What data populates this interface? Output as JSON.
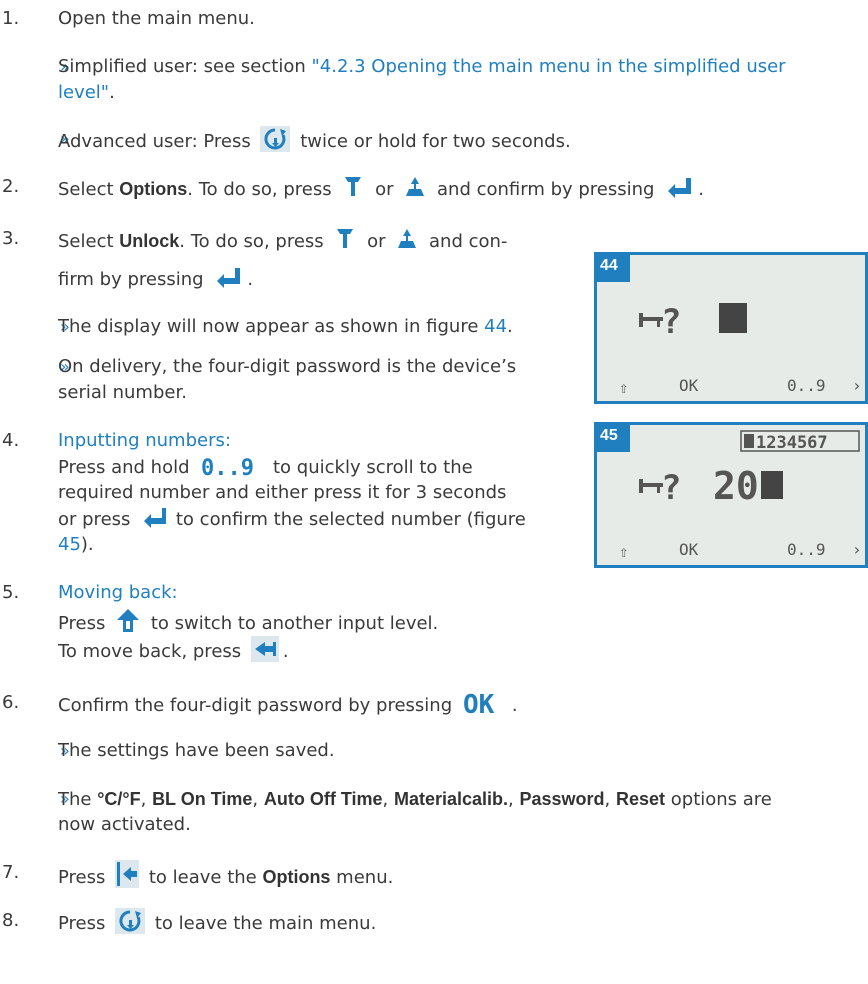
{
  "steps": {
    "s1": {
      "n": "1.",
      "text": "Open the main menu."
    },
    "s1a": {
      "mark": "»",
      "before": "Simplified user: see section ",
      "link1": "\"4.2.3 Opening the main menu in the simplified user",
      "link2": "level\"",
      "after": "."
    },
    "s1b": {
      "mark": "»",
      "before": "Advanced user: Press",
      "after": "twice or hold for two seconds."
    },
    "s2": {
      "n": "2.",
      "before": "Select ",
      "bold": "Options",
      "mid": ". To do so, press",
      "or": "or",
      "after": "and confirm by pressing",
      "end": "."
    },
    "s3": {
      "n": "3.",
      "before": "Select ",
      "bold": "Unlock",
      "mid": ". To do so, press",
      "or": "or",
      "after": "and con-",
      "line2": "firm by pressing",
      "end": "."
    },
    "s3a": {
      "mark": "»",
      "before": "The display will now appear as shown in figure ",
      "link": "44",
      "after": "."
    },
    "s3b": {
      "mark": "»",
      "line1": "On delivery, the four-digit password is the device’s",
      "line2": "serial number."
    },
    "s4": {
      "n": "4.",
      "title": "Inputting numbers:",
      "l1a": "Press and hold",
      "l1b": "to quickly scroll to the",
      "l2": "required number and either press it for 3 seconds",
      "l3a": "or press",
      "l3b": "to confirm the selected number (figure",
      "l4link": "45",
      "l4end": ")."
    },
    "s5": {
      "n": "5.",
      "title": "Moving back:",
      "l1a": "Press",
      "l1b": "to switch to another input level.",
      "l2a": "To move back, press",
      "l2end": "."
    },
    "s6": {
      "n": "6.",
      "before": "Confirm the four-digit password by pressing",
      "end": "."
    },
    "s6a": {
      "mark": "»",
      "text": "The settings have been saved."
    },
    "s6b": {
      "mark": "»",
      "the": "The ",
      "o1": "°C/°F",
      "o2": "BL On Time",
      "o3": "Auto Off Time",
      "o4": "Materialcalib.",
      "o5": "Password",
      "o6": "Reset",
      "comma": ", ",
      "after": " options are",
      "line2": "now activated."
    },
    "s7": {
      "n": "7.",
      "before": "Press",
      "mid": "to leave the ",
      "bold": "Options",
      "after": " menu."
    },
    "s8": {
      "n": "8.",
      "before": "Press",
      "after": "to leave the main menu."
    }
  },
  "icons": {
    "mainmenu": "main-menu-icon",
    "down": "arrow-down-icon",
    "up": "arrow-up-icon",
    "enter": "enter-icon",
    "digits": "0..9",
    "shift": "shift-up-icon",
    "back": "back-icon",
    "ok": "OK",
    "exit": "exit-icon"
  },
  "figures": {
    "f44": {
      "label": "44",
      "prompt": "?",
      "bottom": {
        "shift": "⇧",
        "ok": "OK",
        "digits": "0..9",
        "next": "›"
      }
    },
    "f45": {
      "label": "45",
      "serial": "1234567",
      "prompt": "?",
      "value": "20",
      "bottom": {
        "shift": "⇧",
        "ok": "OK",
        "digits": "0..9",
        "next": "›"
      }
    }
  },
  "colors": {
    "accent": "#1f7fbf",
    "lcd": "#e6ebe8"
  }
}
